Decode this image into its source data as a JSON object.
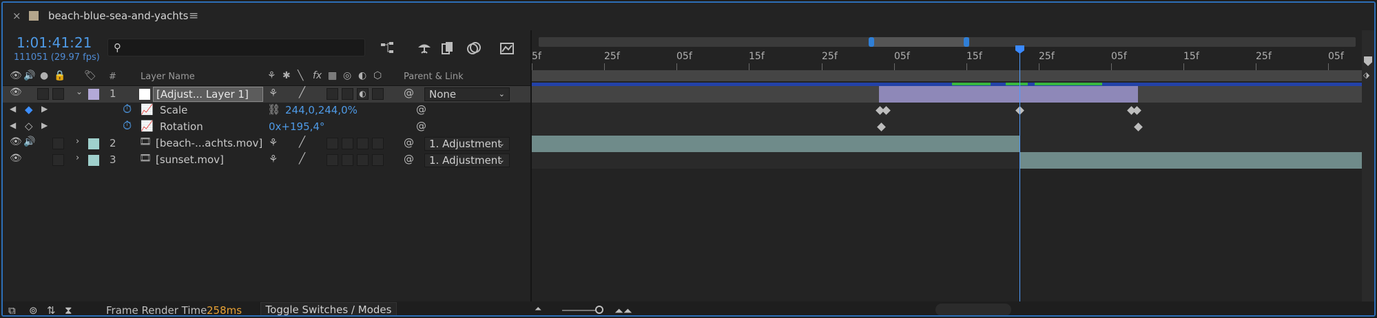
{
  "tab": {
    "title": "beach-blue-sea-and-yachts",
    "close": "×",
    "menu": "≡"
  },
  "timecode": "1:01:41:21",
  "fps_text": "111051 (29.97 fps)",
  "search": {
    "placeholder": ""
  },
  "columns": {
    "number": "#",
    "layer_name": "Layer Name",
    "parent_link": "Parent & Link"
  },
  "layers": [
    {
      "num": "1",
      "name": "[Adjust... Layer 1]",
      "parent": "None",
      "swatch": "#b3a9d8"
    },
    {
      "num": "2",
      "name": "[beach-...achts.mov]",
      "parent": "1. Adjustment",
      "swatch": "#9fd0cc"
    },
    {
      "num": "3",
      "name": "[sunset.mov]",
      "parent": "1. Adjustment",
      "swatch": "#9fd0cc"
    }
  ],
  "properties": [
    {
      "name": "Scale",
      "value": "244,0,244,0%"
    },
    {
      "name": "Rotation",
      "value": "0x+195,4°"
    }
  ],
  "ruler_labels": [
    "5f",
    "25f",
    "05f",
    "15f",
    "25f",
    "05f",
    "15f",
    "25f",
    "05f",
    "15f",
    "25f",
    "05f"
  ],
  "bottom": {
    "render_label": "Frame Render Time",
    "render_value": "258ms",
    "toggle": "Toggle Switches / Modes"
  },
  "colors": {
    "accent": "#2c6fb8",
    "timecode": "#4e9ae6",
    "render": "#e7a135"
  }
}
